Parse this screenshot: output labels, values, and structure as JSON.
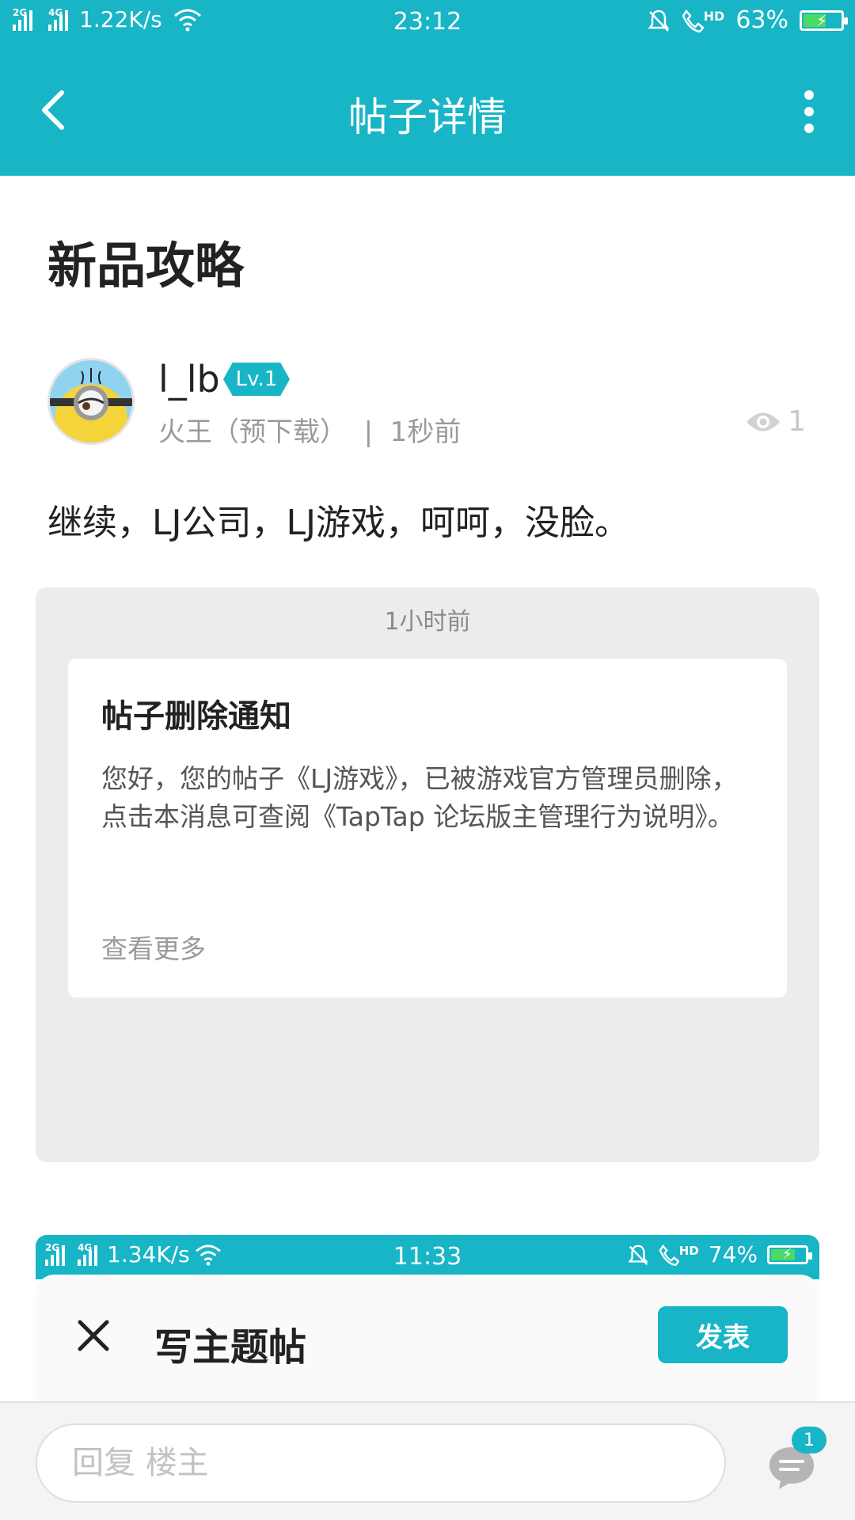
{
  "status_bar": {
    "net1": "2G",
    "net2": "4G",
    "speed": "1.22K/s",
    "time": "23:12",
    "hd": "HD",
    "battery": "63%",
    "battery_level": 0.63
  },
  "app_bar": {
    "title": "帖子详情"
  },
  "post": {
    "title": "新品攻略",
    "username": "l_lb",
    "level": "Lv.1",
    "meta": "火王（预下载）  |  1秒前",
    "views": "1",
    "body": "继续，LJ公司，LJ游戏，呵呵，没脸。"
  },
  "embedded_notice": {
    "time": "1小时前",
    "title": "帖子删除通知",
    "body": "您好，您的帖子《LJ游戏》，已被游戏官方管理员删除，点击本消息可查阅《TapTap 论坛版主管理行为说明》。",
    "more": "查看更多"
  },
  "embedded_editor": {
    "net1": "2G",
    "net2": "4G",
    "speed": "1.34K/s",
    "time": "11:33",
    "hd": "HD",
    "battery": "74%",
    "battery_level": 0.74,
    "title": "写主题帖",
    "publish": "发表"
  },
  "reply_bar": {
    "placeholder": "回复  楼主",
    "badge": "1"
  },
  "colors": {
    "accent": "#17b5c6",
    "embed_bg": "#ececec"
  }
}
